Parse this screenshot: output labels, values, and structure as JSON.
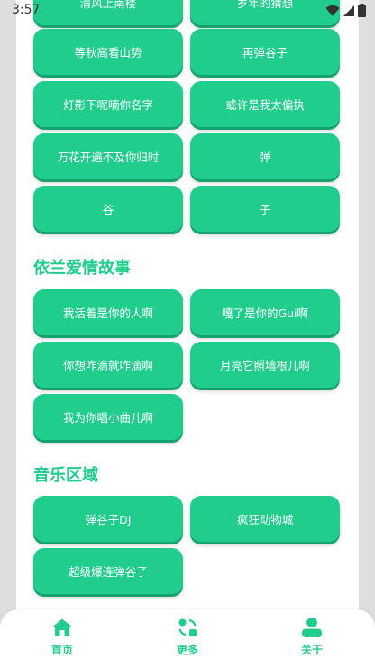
{
  "status": {
    "time": "3:57"
  },
  "top_partial": [
    "清风上南楼",
    "岁年的猜想"
  ],
  "groups": [
    {
      "buttons": [
        "等秋高看山势",
        "再弹谷子",
        "灯影下呢喃你名字",
        "或许是我太偏执",
        "万花开遍不及你归时",
        "弹",
        "谷",
        "子"
      ]
    },
    {
      "title": "依兰爱情故事",
      "buttons": [
        "我活着是你的人啊",
        "嘎了是你的Gui啊",
        "你想咋滴就咋滴啊",
        "月亮它照墙根儿啊",
        "我为你唱小曲儿啊"
      ]
    },
    {
      "title": "音乐区域",
      "buttons": [
        "弹谷子DJ",
        "疯狂动物城",
        "超级爆连弹谷子"
      ]
    }
  ],
  "nav": {
    "home": "首页",
    "more": "更多",
    "about": "关于"
  },
  "colors": {
    "accent": "#21cd8d"
  }
}
